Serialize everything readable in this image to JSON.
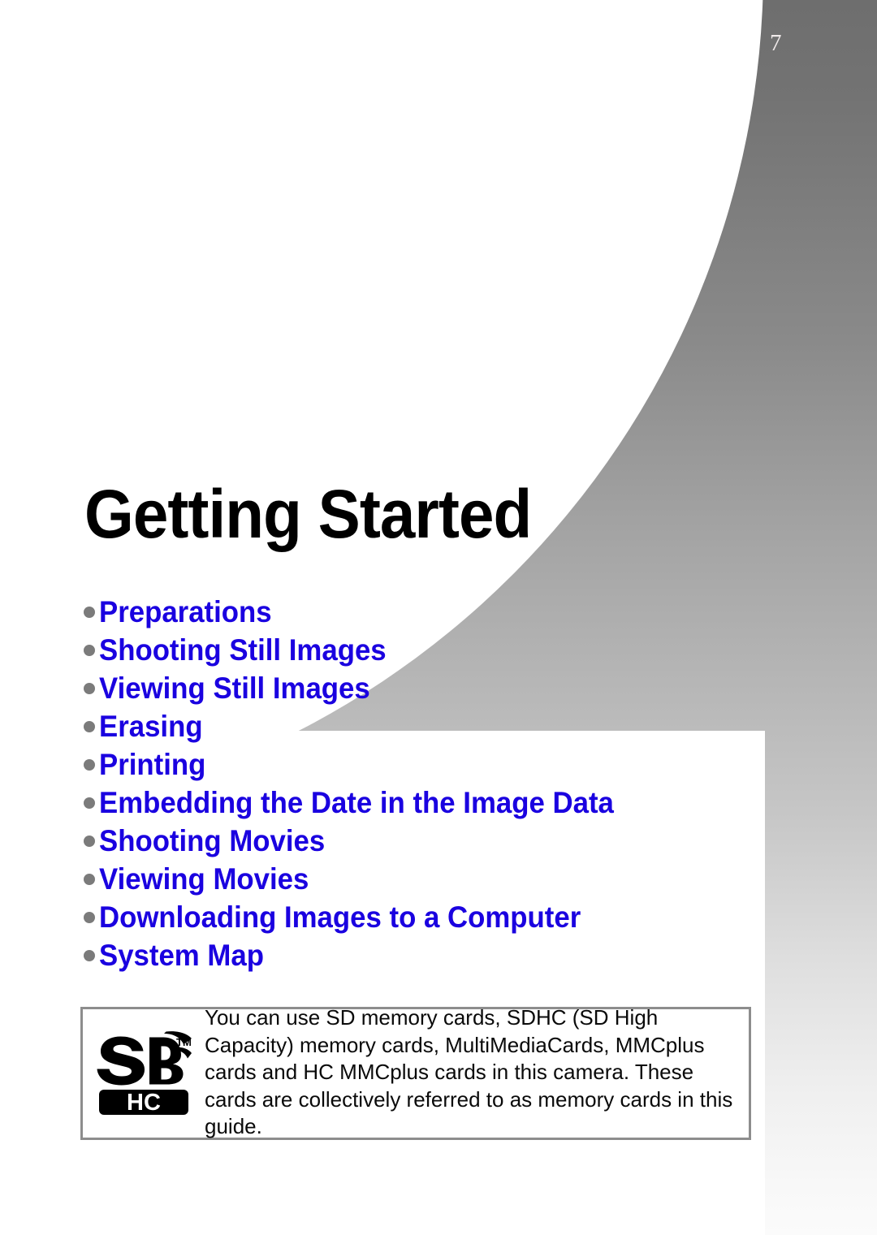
{
  "page": {
    "number": "7",
    "title": "Getting Started"
  },
  "colors": {
    "heading_text": "#000000",
    "list_text": "#1a00e0",
    "bullet": "#7b7b7b",
    "background_top": "#6e6e6e",
    "background_bottom": "#fbfbfb",
    "note_border": "#8d8d8d",
    "page_number_text": "#f0eaea"
  },
  "contents": {
    "items": [
      {
        "label": "Preparations"
      },
      {
        "label": "Shooting Still Images"
      },
      {
        "label": "Viewing Still Images"
      },
      {
        "label": "Erasing"
      },
      {
        "label": "Printing"
      },
      {
        "label": "Embedding the Date in the Image Data"
      },
      {
        "label": "Shooting Movies"
      },
      {
        "label": "Viewing Movies"
      },
      {
        "label": "Downloading Images to a Computer"
      },
      {
        "label": "System Map"
      }
    ]
  },
  "note": {
    "logo_name": "sdhc-logo",
    "logo_text_top": "SD",
    "logo_trademark": "TM",
    "logo_text_bottom": "HC",
    "body": "You can use SD memory cards, SDHC (SD High Capacity) memory cards, MultiMediaCards, MMCplus cards and HC MMCplus cards in this camera. These cards are collectively referred to as memory cards in this guide."
  }
}
